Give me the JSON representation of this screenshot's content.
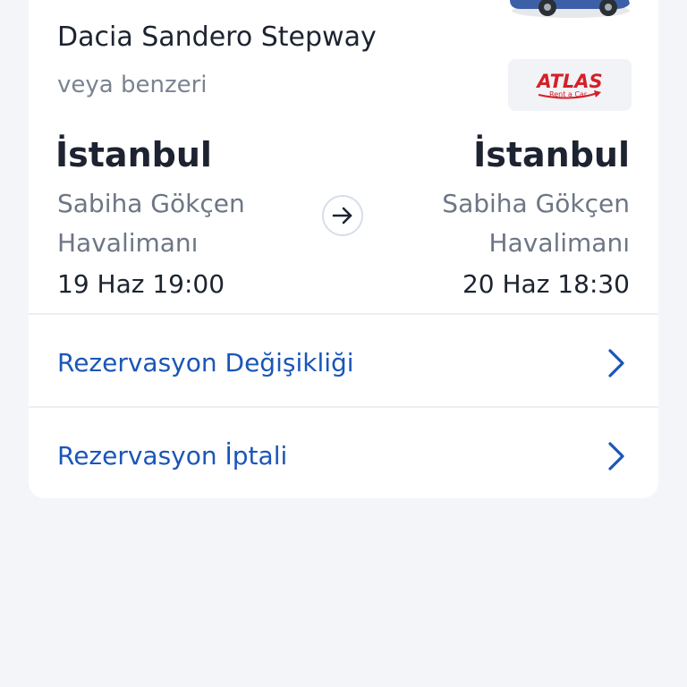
{
  "car": {
    "image_icon": "car-image",
    "name": "Dacia Sandero Stepway",
    "similar_label": "veya benzeri",
    "brand_logo": {
      "name": "ATLAS",
      "tagline": "Rent a Car",
      "color": "#d42028"
    }
  },
  "pickup": {
    "city": "İstanbul",
    "location": "Sabiha Gökçen Havalimanı",
    "datetime": "19 Haz 19:00"
  },
  "dropoff": {
    "city": "İstanbul",
    "location": "Sabiha Gökçen Havalimanı",
    "datetime": "20 Haz 18:30"
  },
  "route_icon": "arrow-right-icon",
  "actions": [
    {
      "label": "Rezervasyon Değişikliği",
      "icon": "chevron-right-icon"
    },
    {
      "label": "Rezervasyon İptali",
      "icon": "chevron-right-icon"
    }
  ],
  "colors": {
    "background": "#f3f5f9",
    "card": "#ffffff",
    "link": "#1a56b8",
    "text_primary": "#1d2330",
    "text_secondary": "#6d7685"
  }
}
